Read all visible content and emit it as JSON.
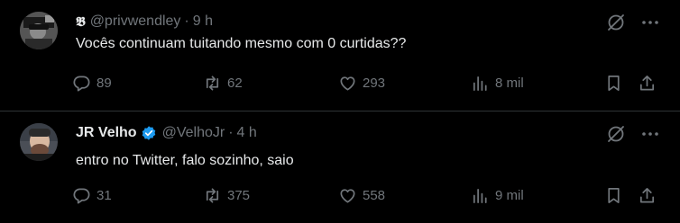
{
  "tweets": [
    {
      "logo_text": "𝕭",
      "name": "",
      "handle": "@privwendley",
      "dot": "·",
      "time": "9 h",
      "text": "Vocês continuam tuitando mesmo com 0 curtidas??",
      "verified": false,
      "replies": "89",
      "retweets": "62",
      "likes": "293",
      "views": "8 mil"
    },
    {
      "logo_text": "",
      "name": "JR Velho",
      "handle": "@VelhoJr",
      "dot": "·",
      "time": "4 h",
      "text": "entro no Twitter, falo sozinho, saio",
      "verified": true,
      "replies": "31",
      "retweets": "375",
      "likes": "558",
      "views": "9 mil"
    }
  ],
  "colors": {
    "background": "#000000",
    "text_primary": "#e7e9ea",
    "text_secondary": "#71767b",
    "verified": "#1d9bf0",
    "divider": "#2f3336"
  },
  "icons": [
    "grok-icon",
    "more-icon",
    "reply-icon",
    "retweet-icon",
    "like-icon",
    "views-icon",
    "bookmark-icon",
    "share-icon",
    "verified-badge-icon"
  ]
}
